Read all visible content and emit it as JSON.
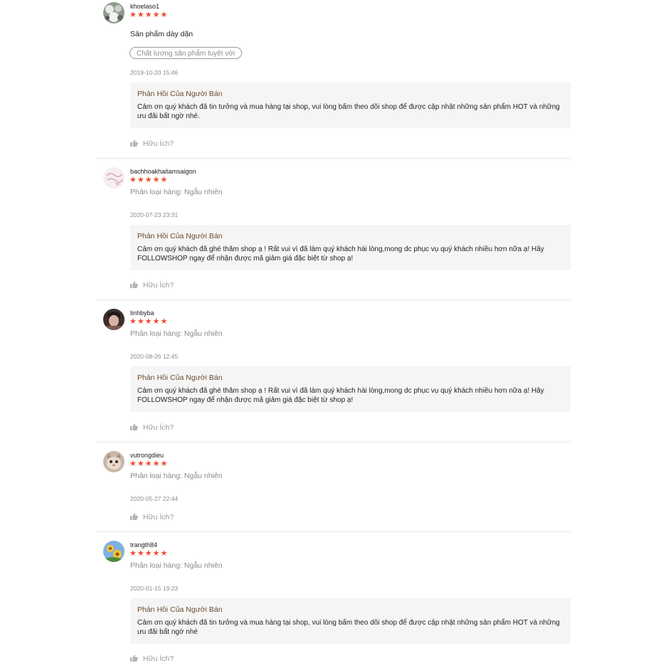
{
  "reviews": [
    {
      "username": "khoelaso1",
      "stars": "★★★★★",
      "comment": "Sản phẩm dày dặn",
      "tag": "Chất lượng sản phẩm tuyệt vời",
      "date": "2019-10-20 15:46",
      "reply_title": "Phản Hồi Của Người Bán",
      "reply_text": "Cảm ơn quý khách đã tin tưởng và mua hàng tại shop, vui lòng bấm theo dõi shop để được cập nhật những sản phẩm HOT và những ưu đãi bất ngờ nhé.",
      "helpful": "Hữu Ích?"
    },
    {
      "username": "bachhoakhaitamsaigon",
      "stars": "★★★★★",
      "variation": "Phân loại hàng: Ngẫu nhiên",
      "date": "2020-07-23 23:31",
      "reply_title": "Phản Hồi Của Người Bán",
      "reply_text": "Cảm ơn quý khách đã ghé thăm shop ạ ! Rất vui vì đã làm quý khách hài lòng,mong dc phục vụ quý khách nhiều hơn nữa ạ! Hãy FOLLOWSHOP ngay để nhận được mã giảm giá đặc biệt từ shop ạ!",
      "helpful": "Hữu Ích?"
    },
    {
      "username": "linhbyba",
      "stars": "★★★★★",
      "variation": "Phân loại hàng: Ngẫu nhiên",
      "date": "2020-08-26 12:45",
      "reply_title": "Phản Hồi Của Người Bán",
      "reply_text": "Cảm ơn quý khách đã ghé thăm shop ạ ! Rất vui vì đã làm quý khách hài lòng,mong dc phục vụ quý khách nhiều hơn nữa ạ! Hãy FOLLOWSHOP ngay để nhận được mã giảm giá đặc biệt từ shop ạ!",
      "helpful": "Hữu Ích?"
    },
    {
      "username": "vutrongdieu",
      "stars": "★★★★★",
      "variation": "Phân loại hàng: Ngẫu nhiên",
      "date": "2020-05-27 22:44",
      "helpful": "Hữu Ích?"
    },
    {
      "username": "trangth84",
      "stars": "★★★★★",
      "variation": "Phân loại hàng: Ngẫu nhiên",
      "date": "2020-01-15 19:23",
      "reply_title": "Phản Hồi Của Người Bán",
      "reply_text": "Cảm ơn quý khách đã tin tưởng và mua hàng tại shop, vui lòng bấm theo dõi shop để được cập nhật những sản phẩm HOT và những ưu đãi bất ngờ nhé",
      "helpful": "Hữu Ích?"
    }
  ],
  "colors": {
    "star": "#ee4d2d",
    "reply_title": "#6b4a2e",
    "reply_bg": "#f5f5f5",
    "muted": "#8a8a8a"
  },
  "icons": {
    "helpful": "thumbs-up-icon"
  }
}
